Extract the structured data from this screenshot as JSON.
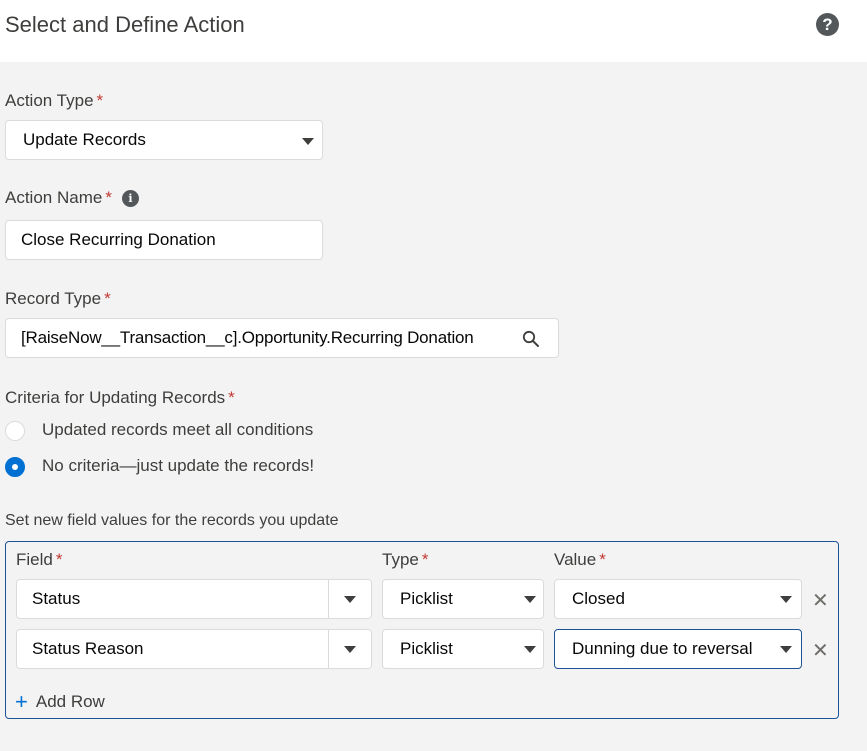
{
  "header": {
    "title": "Select and Define Action",
    "help_icon": "?"
  },
  "action_type": {
    "label": "Action Type",
    "required": "*",
    "value": "Update Records"
  },
  "action_name": {
    "label": "Action Name",
    "required": "*",
    "info_icon": "i",
    "value": "Close Recurring Donation"
  },
  "record_type": {
    "label": "Record Type",
    "required": "*",
    "value": "[RaiseNow__Transaction__c].Opportunity.Recurring Donation"
  },
  "criteria": {
    "label": "Criteria for Updating Records",
    "required": "*",
    "options": [
      {
        "label": "Updated records meet all conditions",
        "selected": false
      },
      {
        "label": "No criteria—just update the records!",
        "selected": true
      }
    ]
  },
  "field_values": {
    "label": "Set new field values for the records you update",
    "headers": {
      "field": "Field",
      "type": "Type",
      "value": "Value",
      "required": "*"
    },
    "rows": [
      {
        "field": "Status",
        "type": "Picklist",
        "value": "Closed"
      },
      {
        "field": "Status Reason",
        "type": "Picklist",
        "value": "Dunning due to reversal"
      }
    ],
    "add_row_label": "Add Row"
  },
  "colors": {
    "accent": "#0070d2",
    "required": "#c23934",
    "focus": "#1b5297"
  }
}
